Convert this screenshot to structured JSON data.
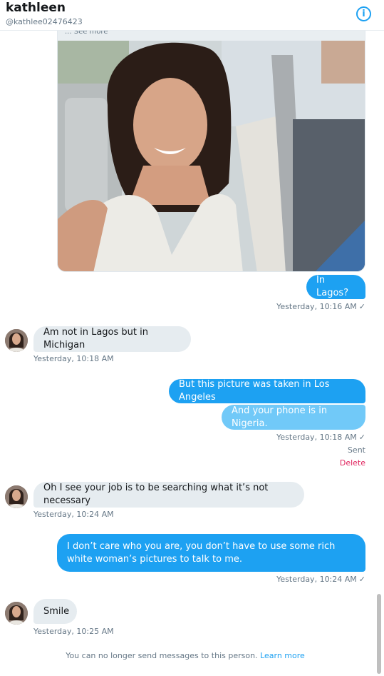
{
  "header": {
    "name": "kathleen",
    "handle": "@kathlee02476423",
    "info_icon": "info-icon",
    "info_glyph": "i"
  },
  "photo": {
    "see_more": "... See more"
  },
  "messages": [
    {
      "text": "In Lagos?",
      "time": "Yesterday, 10:16 AM",
      "check": "✓"
    },
    {
      "text": "Am not in Lagos but in Michigan",
      "time": "Yesterday, 10:18 AM"
    },
    {
      "text": "But this picture was taken in Los Angeles"
    },
    {
      "text": "And your phone is in Nigeria.",
      "time": "Yesterday, 10:18 AM",
      "check": "✓",
      "status": "Sent",
      "action": "Delete"
    },
    {
      "text": "Oh I see your job is to be searching what it’s not necessary",
      "time": "Yesterday, 10:24 AM"
    },
    {
      "text": "I don’t care who you are, you don’t have to use some rich white woman’s pictures to talk to me.",
      "time": "Yesterday, 10:24 AM",
      "check": "✓"
    },
    {
      "text": "Smile",
      "time": "Yesterday, 10:25 AM"
    }
  ],
  "footer": {
    "text": "You can no longer send messages to this person.",
    "link": "Learn more"
  },
  "colors": {
    "accent": "#1da1f2",
    "outgoing_light": "#71c9f8",
    "incoming": "#e6ecf0",
    "delete": "#e0245e"
  }
}
